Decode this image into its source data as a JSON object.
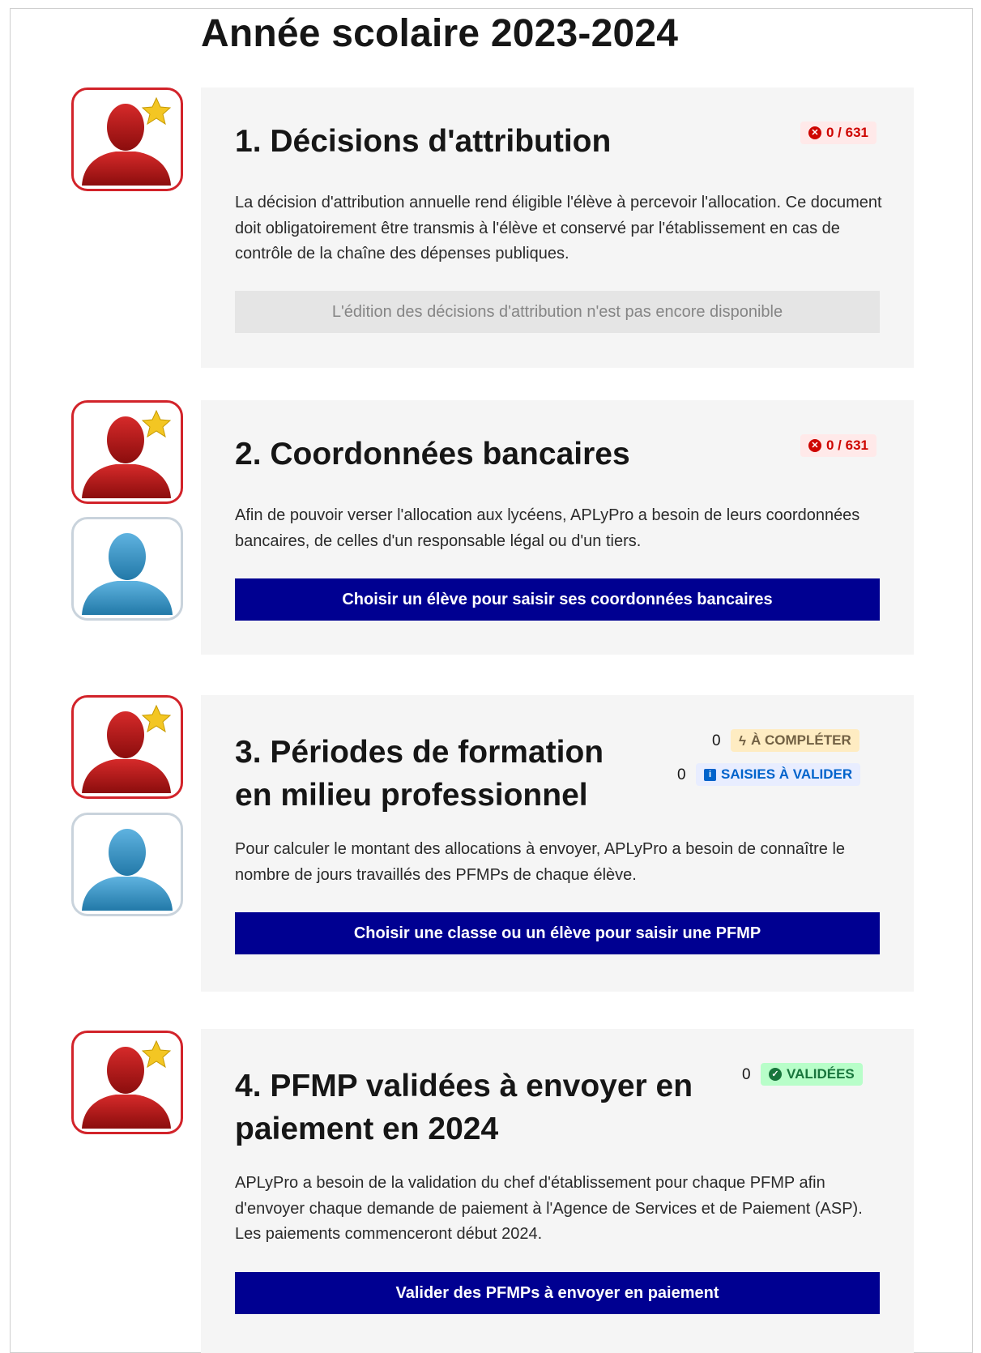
{
  "page": {
    "title": "Année scolaire 2023-2024"
  },
  "steps": [
    {
      "title": "1. Décisions d'attribution",
      "badge": "0 / 631",
      "description": "La décision d'attribution annuelle rend éligible l'élève à percevoir l'allocation. Ce document doit obligatoirement être transmis à l'élève et conservé par l'établissement en cas de contrôle de la chaîne des dépenses publiques.",
      "action_label": "L'édition des décisions d'attribution n'est pas encore disponible"
    },
    {
      "title": "2. Coordonnées bancaires",
      "badge": "0 / 631",
      "description": "Afin de pouvoir verser l'allocation aux lycéens, APLyPro a besoin de leurs coordonnées bancaires, de celles d'un responsable légal ou d'un tiers.",
      "action_label": "Choisir un élève pour saisir ses coordonnées bancaires"
    },
    {
      "title_line1": "3. Périodes de formation",
      "title_line2": "en milieu professionnel",
      "badges": [
        {
          "count": "0",
          "label": "À COMPLÉTER"
        },
        {
          "count": "0",
          "label": "SAISIES À VALIDER"
        }
      ],
      "description": "Pour calculer le montant des allocations à envoyer, APLyPro a besoin de connaître le nombre de jours travaillés des PFMPs de chaque élève.",
      "action_label": "Choisir une classe ou un élève pour saisir une PFMP"
    },
    {
      "title_line1": "4. PFMP validées à envoyer en",
      "title_line2": "paiement en 2024",
      "badge_count": "0",
      "badge_label": "VALIDÉES",
      "description": "APLyPro a besoin de la validation du chef d'établissement pour chaque PFMP afin d'envoyer chaque demande de paiement à l'Agence de Services et de Paiement (ASP). Les paiements commenceront début 2024.",
      "action_label": "Valider des PFMPs à envoyer en paiement"
    }
  ],
  "icons": {
    "error": "x-circle-icon",
    "warning": "bolt-icon",
    "info": "info-icon",
    "success": "check-circle-icon",
    "user_red": "user-star-icon",
    "user_blue": "user-icon"
  },
  "colors": {
    "primary": "#000091",
    "card_bg": "#f5f5f5",
    "error": "#ce0500",
    "success": "#18753c",
    "info": "#0063cb",
    "warning": "#716043"
  }
}
